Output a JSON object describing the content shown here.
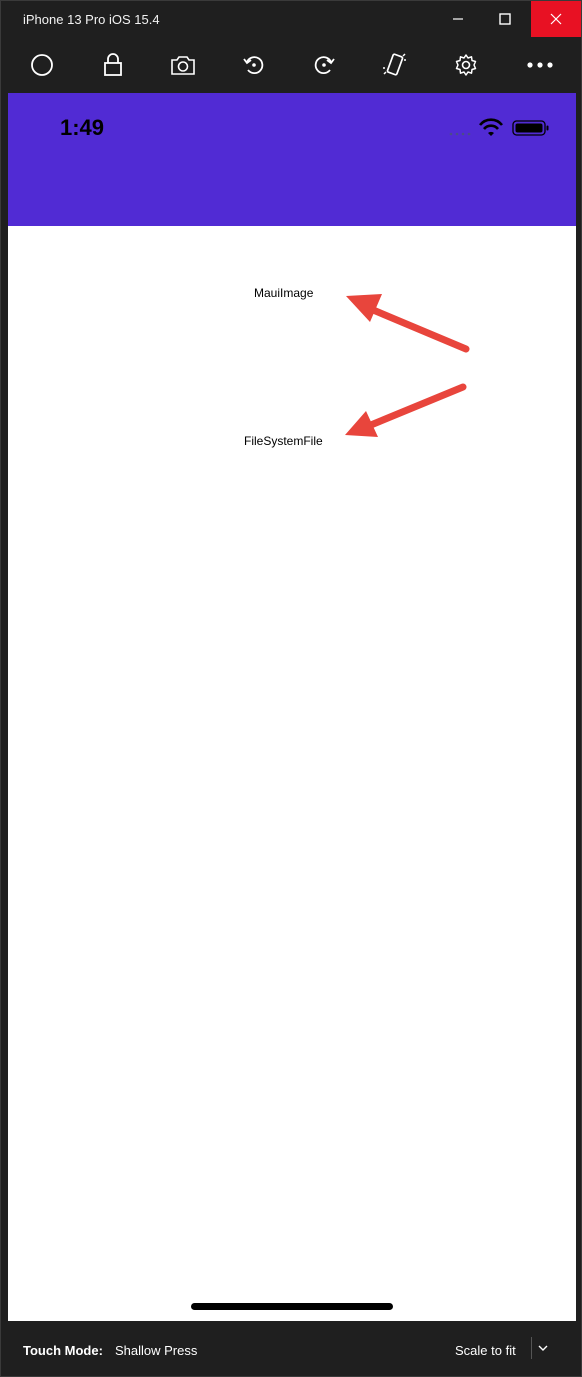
{
  "window": {
    "title": "iPhone 13 Pro iOS 15.4"
  },
  "toolbar": {
    "icons": [
      "home-icon",
      "lock-icon",
      "screenshot-icon",
      "rotate-left-icon",
      "rotate-right-icon",
      "shake-icon",
      "settings-icon",
      "more-icon"
    ]
  },
  "device": {
    "status": {
      "time": "1:49"
    },
    "labels": {
      "maui_image": "MauiImage",
      "file_system_file": "FileSystemFile"
    }
  },
  "bottom": {
    "touch_mode_label": "Touch Mode:",
    "touch_mode_value": "Shallow Press",
    "scale_label": "Scale to fit"
  },
  "colors": {
    "nav_bar": "#512bd4",
    "arrow": "#e8453c",
    "close_button": "#e81123"
  }
}
